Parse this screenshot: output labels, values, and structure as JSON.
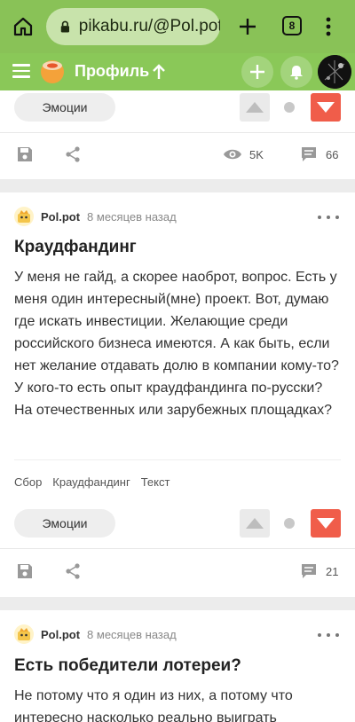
{
  "browser": {
    "url": "pikabu.ru/@Pol.pot?",
    "tab_count": "8"
  },
  "header": {
    "title": "Профиль"
  },
  "card1": {
    "emotions_label": "Эмоции",
    "views": "5K",
    "comments": "66"
  },
  "post1": {
    "author": "Pol.pot",
    "time": "8 месяцев назад",
    "title": "Краудфандинг",
    "body": "У меня не гайд, а скорее наоброт, вопрос. Есть у меня один интересный(мне) проект. Вот, думаю где искать инвестиции. Желающие среди российского бизнеса имеются. А как быть, если нет желание отдавать долю в компании кому-то? У кого-то есть опыт краудфандинга по-русски? На отечественных или зарубежных площадках?",
    "tags": [
      "Сбор",
      "Краудфандинг",
      "Текст"
    ],
    "emotions_label": "Эмоции",
    "comments": "21"
  },
  "post2": {
    "author": "Pol.pot",
    "time": "8 месяцев назад",
    "title": "Есть победители лотереи?",
    "body": "Не потому что я один из них, а потому что интересно насколько реально выиграть"
  },
  "colors": {
    "browser_bar": "#89c257",
    "site_header": "#8ac858",
    "downvote": "#f05d4a"
  }
}
